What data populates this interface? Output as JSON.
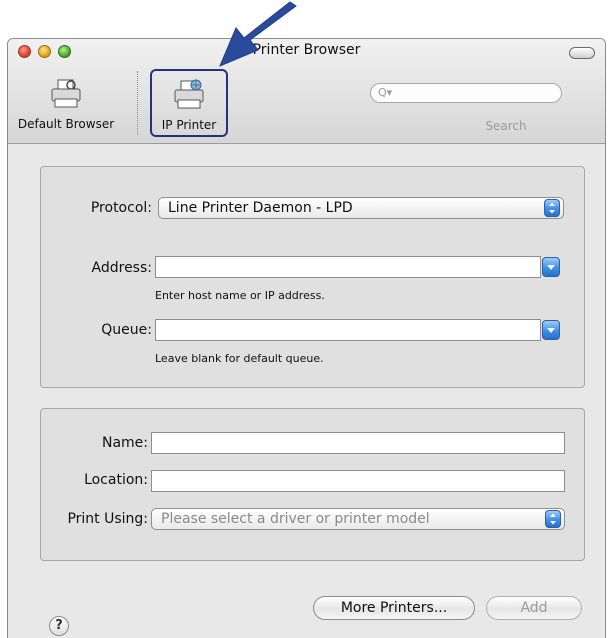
{
  "window": {
    "title": "Printer Browser"
  },
  "toolbar": {
    "items": [
      {
        "label": "Default Browser",
        "icon": "printer-icon",
        "selected": false
      },
      {
        "label": "IP Printer",
        "icon": "network-printer-icon",
        "selected": true
      }
    ],
    "search": {
      "placeholder": "",
      "label": "Search",
      "icon": "magnifier-icon"
    }
  },
  "form": {
    "protocol": {
      "label": "Protocol:",
      "value": "Line Printer Daemon - LPD"
    },
    "address": {
      "label": "Address:",
      "value": "",
      "hint": "Enter host name or IP address."
    },
    "queue": {
      "label": "Queue:",
      "value": "",
      "hint": "Leave blank for default queue."
    },
    "name": {
      "label": "Name:",
      "value": ""
    },
    "location": {
      "label": "Location:",
      "value": ""
    },
    "print_using": {
      "label": "Print Using:",
      "value": "Please select a driver or printer model"
    }
  },
  "buttons": {
    "help": "?",
    "more_printers": "More Printers...",
    "add": "Add"
  },
  "annotation": {
    "arrow_color": "#2a4a9c",
    "highlight_color": "#23347c"
  }
}
